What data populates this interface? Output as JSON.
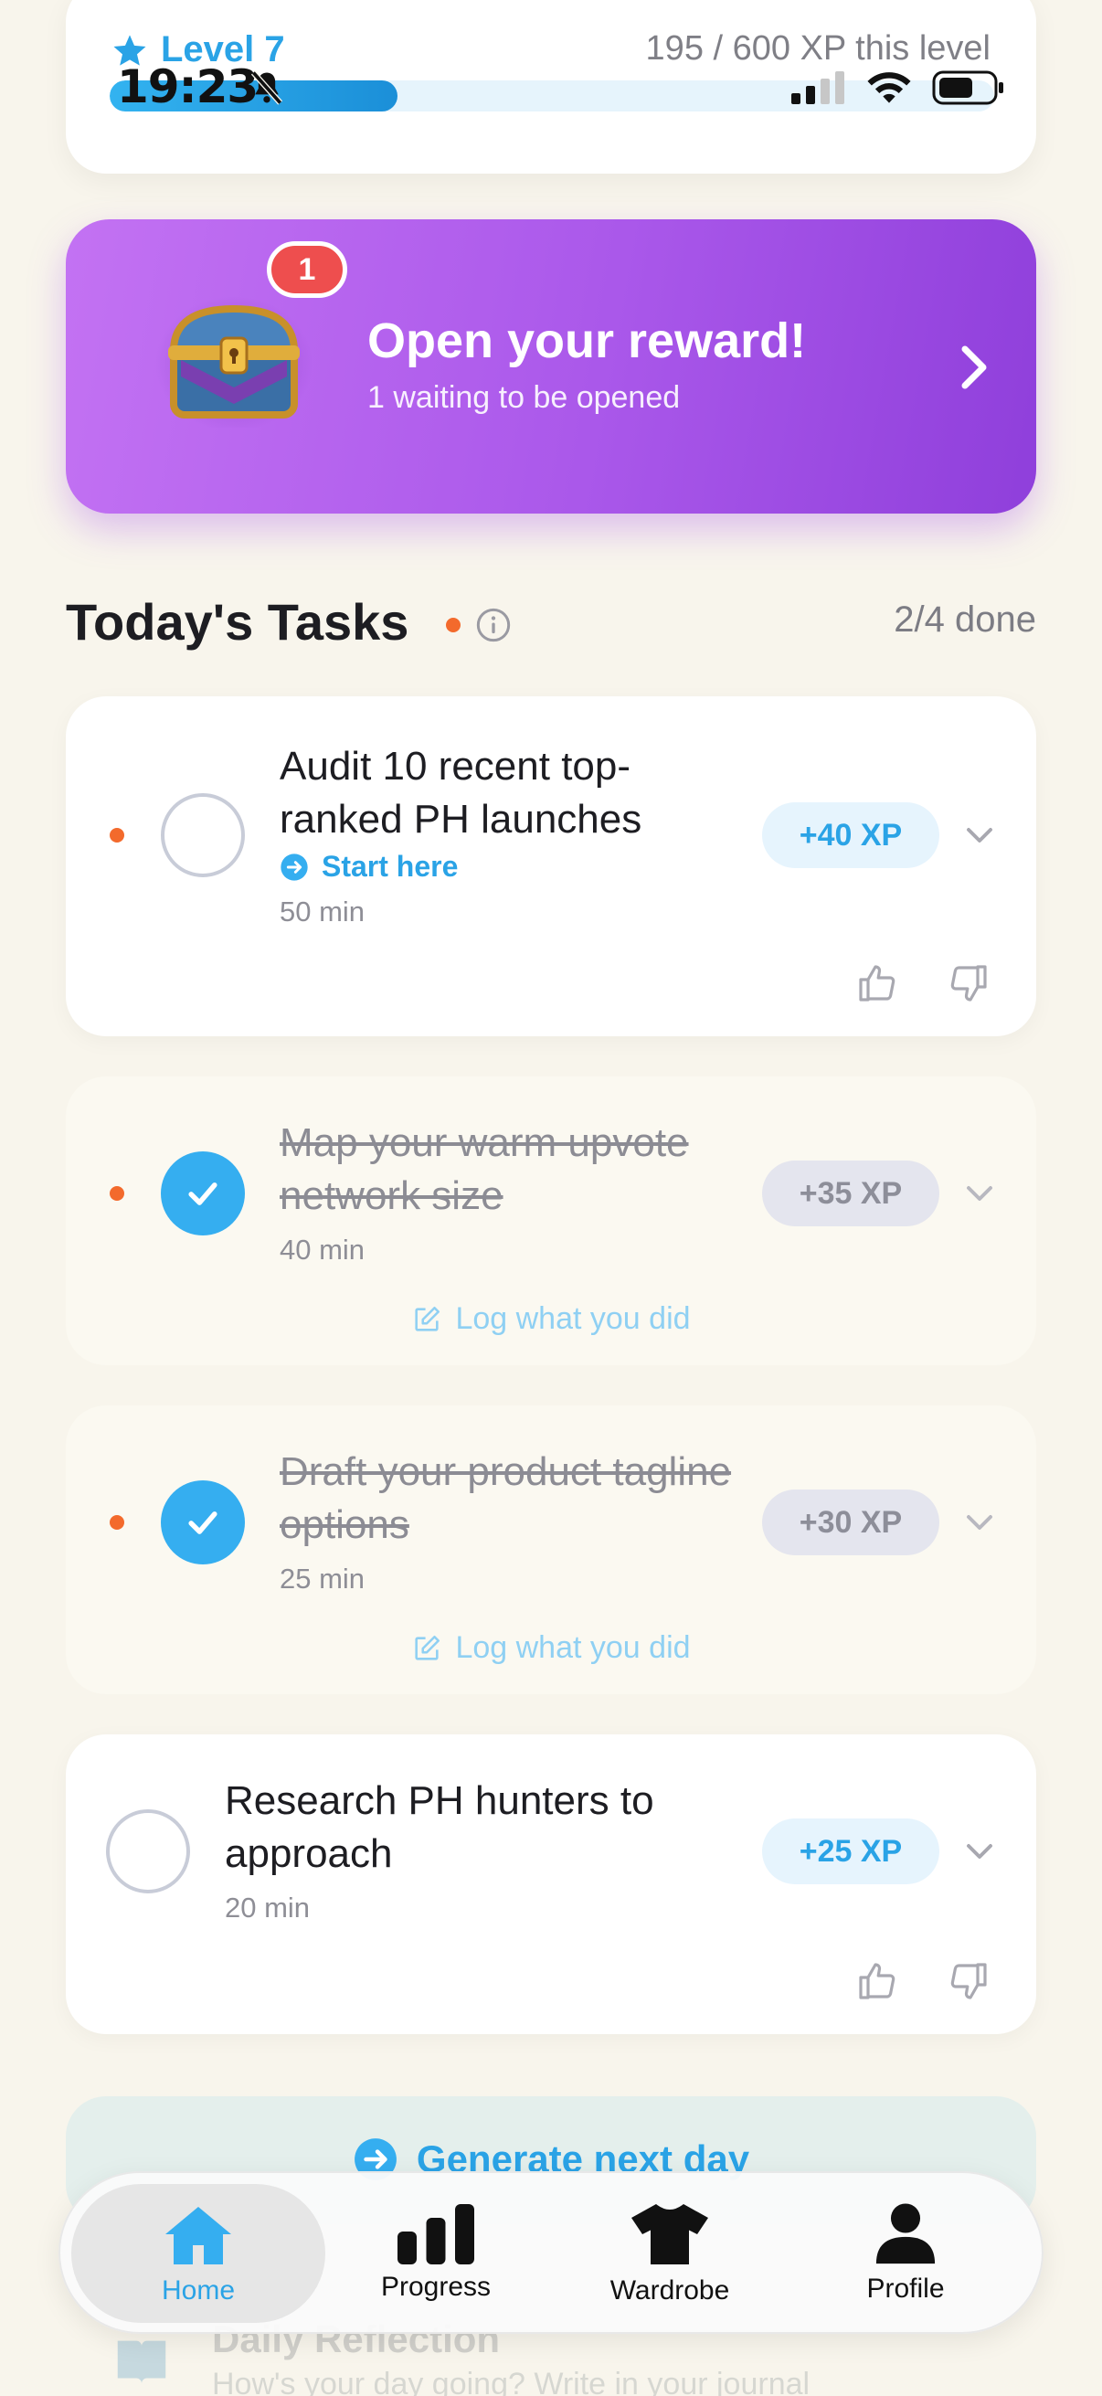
{
  "status_bar": {
    "time": "19:23"
  },
  "level": {
    "title": "Level 7",
    "xp_text": "195 / 600 XP this level",
    "progress": 0.325
  },
  "reward": {
    "badge_count": "1",
    "title": "Open your reward!",
    "subtitle": "1 waiting to be opened"
  },
  "tasks_header": {
    "title": "Today's Tasks",
    "count": "2/4 done"
  },
  "tasks": [
    {
      "title": "Audit 10 recent top-ranked PH launches",
      "link": "Start here",
      "time": "50 min",
      "xp": "+40 XP",
      "done": false
    },
    {
      "title": "Map your warm upvote network size",
      "time": "40 min",
      "xp": "+35 XP",
      "done": true,
      "log": "Log what you did"
    },
    {
      "title": "Draft your product tagline options",
      "time": "25 min",
      "xp": "+30 XP",
      "done": true,
      "log": "Log what you did"
    },
    {
      "title": "Research PH hunters to approach",
      "time": "20 min",
      "xp": "+25 XP",
      "done": false
    }
  ],
  "generate": {
    "label": "Generate next day"
  },
  "reflection": {
    "title": "Daily Reflection",
    "subtitle": "How's your day going? Write in your journal"
  },
  "nav": [
    {
      "label": "Home",
      "icon": "home-icon",
      "active": true
    },
    {
      "label": "Progress",
      "icon": "bar-chart-icon"
    },
    {
      "label": "Wardrobe",
      "icon": "tshirt-icon"
    },
    {
      "label": "Profile",
      "icon": "person-icon"
    }
  ],
  "colors": {
    "accent": "#2aa3e6",
    "reward": "#aa58ea",
    "task_dot": "#f36a2c"
  }
}
